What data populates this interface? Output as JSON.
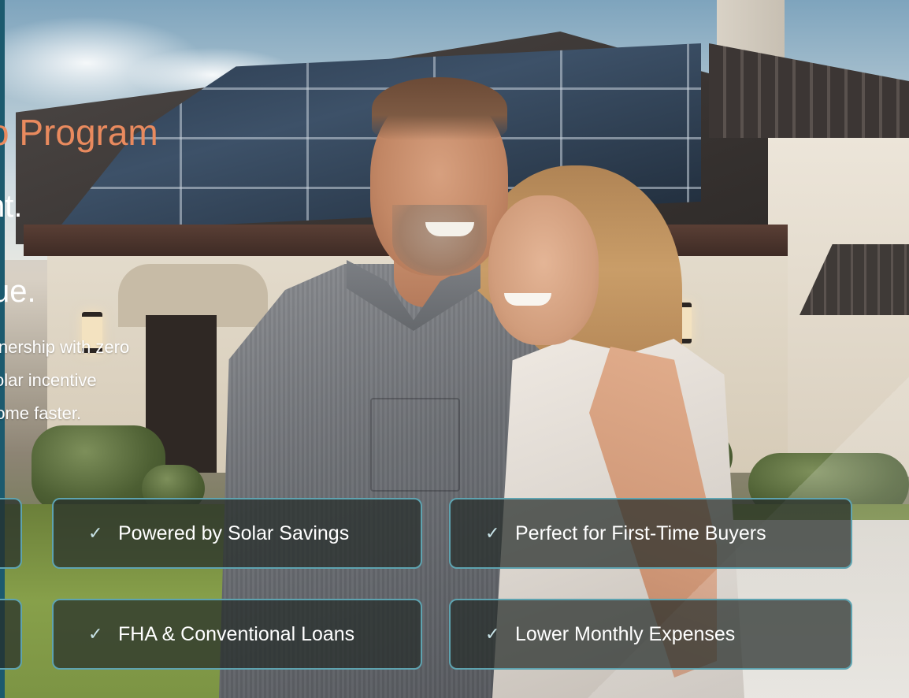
{
  "hero": {
    "heading_fragment": "o Program",
    "line2_fragment": "nt.",
    "line3_fragment": "ue.",
    "body_lines": [
      "wnership with zero",
      "solar incentive",
      "home faster."
    ]
  },
  "features": [
    {
      "label": "Powered by Solar Savings",
      "check": "✓"
    },
    {
      "label": "Perfect for First-Time Buyers",
      "check": "✓"
    },
    {
      "label": "FHA & Conventional Loans",
      "check": "✓"
    },
    {
      "label": "Lower Monthly Expenses",
      "check": "✓"
    }
  ],
  "colors": {
    "accent": "#e98a5e",
    "card_border": "#5ea3b0",
    "rail": "#1c5a6e"
  },
  "icons": [
    "checkmark-icon"
  ]
}
